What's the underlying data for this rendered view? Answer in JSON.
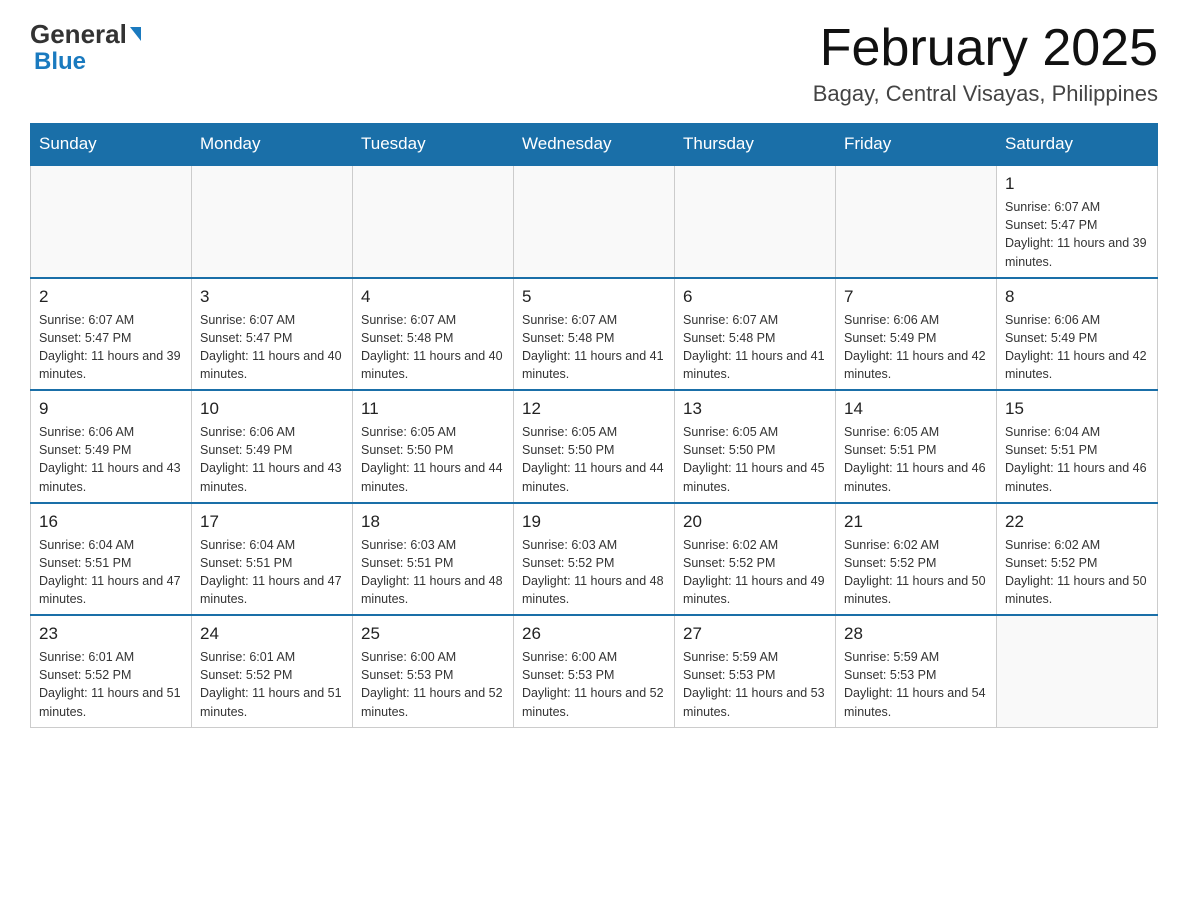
{
  "header": {
    "logo_general": "General",
    "logo_blue": "Blue",
    "main_title": "February 2025",
    "subtitle": "Bagay, Central Visayas, Philippines"
  },
  "weekdays": [
    "Sunday",
    "Monday",
    "Tuesday",
    "Wednesday",
    "Thursday",
    "Friday",
    "Saturday"
  ],
  "weeks": [
    [
      {
        "day": "",
        "info": ""
      },
      {
        "day": "",
        "info": ""
      },
      {
        "day": "",
        "info": ""
      },
      {
        "day": "",
        "info": ""
      },
      {
        "day": "",
        "info": ""
      },
      {
        "day": "",
        "info": ""
      },
      {
        "day": "1",
        "info": "Sunrise: 6:07 AM\nSunset: 5:47 PM\nDaylight: 11 hours and 39 minutes."
      }
    ],
    [
      {
        "day": "2",
        "info": "Sunrise: 6:07 AM\nSunset: 5:47 PM\nDaylight: 11 hours and 39 minutes."
      },
      {
        "day": "3",
        "info": "Sunrise: 6:07 AM\nSunset: 5:47 PM\nDaylight: 11 hours and 40 minutes."
      },
      {
        "day": "4",
        "info": "Sunrise: 6:07 AM\nSunset: 5:48 PM\nDaylight: 11 hours and 40 minutes."
      },
      {
        "day": "5",
        "info": "Sunrise: 6:07 AM\nSunset: 5:48 PM\nDaylight: 11 hours and 41 minutes."
      },
      {
        "day": "6",
        "info": "Sunrise: 6:07 AM\nSunset: 5:48 PM\nDaylight: 11 hours and 41 minutes."
      },
      {
        "day": "7",
        "info": "Sunrise: 6:06 AM\nSunset: 5:49 PM\nDaylight: 11 hours and 42 minutes."
      },
      {
        "day": "8",
        "info": "Sunrise: 6:06 AM\nSunset: 5:49 PM\nDaylight: 11 hours and 42 minutes."
      }
    ],
    [
      {
        "day": "9",
        "info": "Sunrise: 6:06 AM\nSunset: 5:49 PM\nDaylight: 11 hours and 43 minutes."
      },
      {
        "day": "10",
        "info": "Sunrise: 6:06 AM\nSunset: 5:49 PM\nDaylight: 11 hours and 43 minutes."
      },
      {
        "day": "11",
        "info": "Sunrise: 6:05 AM\nSunset: 5:50 PM\nDaylight: 11 hours and 44 minutes."
      },
      {
        "day": "12",
        "info": "Sunrise: 6:05 AM\nSunset: 5:50 PM\nDaylight: 11 hours and 44 minutes."
      },
      {
        "day": "13",
        "info": "Sunrise: 6:05 AM\nSunset: 5:50 PM\nDaylight: 11 hours and 45 minutes."
      },
      {
        "day": "14",
        "info": "Sunrise: 6:05 AM\nSunset: 5:51 PM\nDaylight: 11 hours and 46 minutes."
      },
      {
        "day": "15",
        "info": "Sunrise: 6:04 AM\nSunset: 5:51 PM\nDaylight: 11 hours and 46 minutes."
      }
    ],
    [
      {
        "day": "16",
        "info": "Sunrise: 6:04 AM\nSunset: 5:51 PM\nDaylight: 11 hours and 47 minutes."
      },
      {
        "day": "17",
        "info": "Sunrise: 6:04 AM\nSunset: 5:51 PM\nDaylight: 11 hours and 47 minutes."
      },
      {
        "day": "18",
        "info": "Sunrise: 6:03 AM\nSunset: 5:51 PM\nDaylight: 11 hours and 48 minutes."
      },
      {
        "day": "19",
        "info": "Sunrise: 6:03 AM\nSunset: 5:52 PM\nDaylight: 11 hours and 48 minutes."
      },
      {
        "day": "20",
        "info": "Sunrise: 6:02 AM\nSunset: 5:52 PM\nDaylight: 11 hours and 49 minutes."
      },
      {
        "day": "21",
        "info": "Sunrise: 6:02 AM\nSunset: 5:52 PM\nDaylight: 11 hours and 50 minutes."
      },
      {
        "day": "22",
        "info": "Sunrise: 6:02 AM\nSunset: 5:52 PM\nDaylight: 11 hours and 50 minutes."
      }
    ],
    [
      {
        "day": "23",
        "info": "Sunrise: 6:01 AM\nSunset: 5:52 PM\nDaylight: 11 hours and 51 minutes."
      },
      {
        "day": "24",
        "info": "Sunrise: 6:01 AM\nSunset: 5:52 PM\nDaylight: 11 hours and 51 minutes."
      },
      {
        "day": "25",
        "info": "Sunrise: 6:00 AM\nSunset: 5:53 PM\nDaylight: 11 hours and 52 minutes."
      },
      {
        "day": "26",
        "info": "Sunrise: 6:00 AM\nSunset: 5:53 PM\nDaylight: 11 hours and 52 minutes."
      },
      {
        "day": "27",
        "info": "Sunrise: 5:59 AM\nSunset: 5:53 PM\nDaylight: 11 hours and 53 minutes."
      },
      {
        "day": "28",
        "info": "Sunrise: 5:59 AM\nSunset: 5:53 PM\nDaylight: 11 hours and 54 minutes."
      },
      {
        "day": "",
        "info": ""
      }
    ]
  ]
}
